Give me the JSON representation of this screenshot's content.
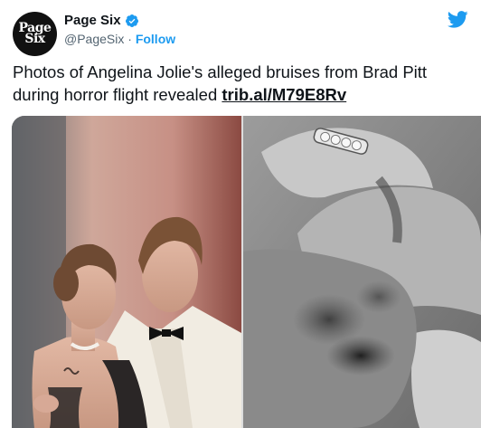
{
  "account": {
    "name": "Page Six",
    "handle": "@PageSix",
    "separator": " · ",
    "follow_label": "Follow",
    "avatar_line1": "Page",
    "avatar_line2": "Six"
  },
  "tweet": {
    "text": "Photos of Angelina Jolie's alleged bruises from Brad Pitt during horror flight revealed ",
    "link": "trib.al/M79E8Rv"
  },
  "icons": {
    "verified": "verified-badge-icon",
    "platform": "twitter-bird-icon"
  },
  "colors": {
    "brand_blue": "#1d9bf0",
    "text": "#0f1419",
    "secondary": "#536471",
    "avatar_bg": "#111111"
  }
}
